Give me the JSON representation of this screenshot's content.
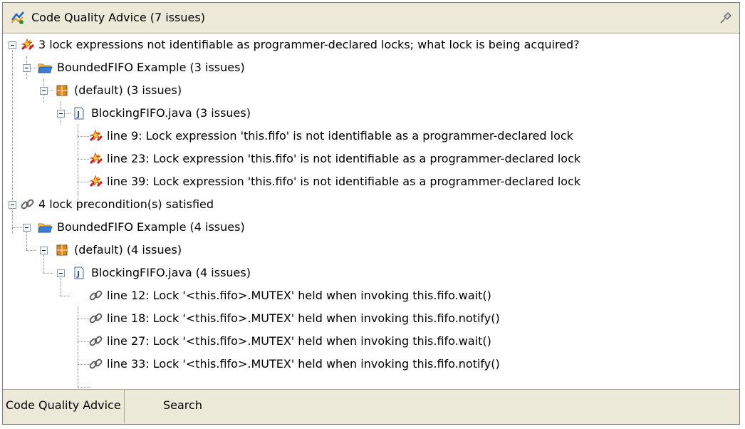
{
  "view": {
    "title": "Code Quality Advice (7 issues)",
    "title_icon": "code-advice-icon",
    "pin_icon": "pin-icon"
  },
  "tree": {
    "groups": [
      {
        "label": "3 lock expressions not identifiable as programmer-declared locks; what lock is being acquired?",
        "icon": "broken-lock-warning-icon",
        "project": {
          "label": "BoundedFIFO Example (3 issues)",
          "icon": "folder-icon",
          "package": {
            "label": "(default) (3 issues)",
            "icon": "package-icon",
            "file": {
              "label": "BlockingFIFO.java (3 issues)",
              "icon": "java-file-icon",
              "issues": [
                "line 9: Lock expression 'this.fifo' is not identifiable as a programmer-declared lock",
                "line 23: Lock expression 'this.fifo' is not identifiable as a programmer-declared lock",
                "line 39: Lock expression 'this.fifo' is not identifiable as a programmer-declared lock"
              ]
            }
          }
        }
      },
      {
        "label": "4 lock precondition(s) satisfied",
        "icon": "chain-link-icon",
        "project": {
          "label": "BoundedFIFO Example (4 issues)",
          "icon": "folder-icon",
          "package": {
            "label": "(default) (4 issues)",
            "icon": "package-icon",
            "file": {
              "label": "BlockingFIFO.java (4 issues)",
              "icon": "java-file-icon",
              "issues": [
                "line 12: Lock '<this.fifo>.MUTEX' held when invoking this.fifo.wait()",
                "line 18: Lock '<this.fifo>.MUTEX' held when invoking this.fifo.notify()",
                "line 27: Lock '<this.fifo>.MUTEX' held when invoking this.fifo.wait()",
                "line 33: Lock '<this.fifo>.MUTEX' held when invoking this.fifo.notify()"
              ]
            }
          }
        }
      }
    ]
  },
  "tabs": [
    {
      "label": "Code Quality Advice",
      "active": true
    },
    {
      "label": "Search",
      "active": false
    }
  ]
}
